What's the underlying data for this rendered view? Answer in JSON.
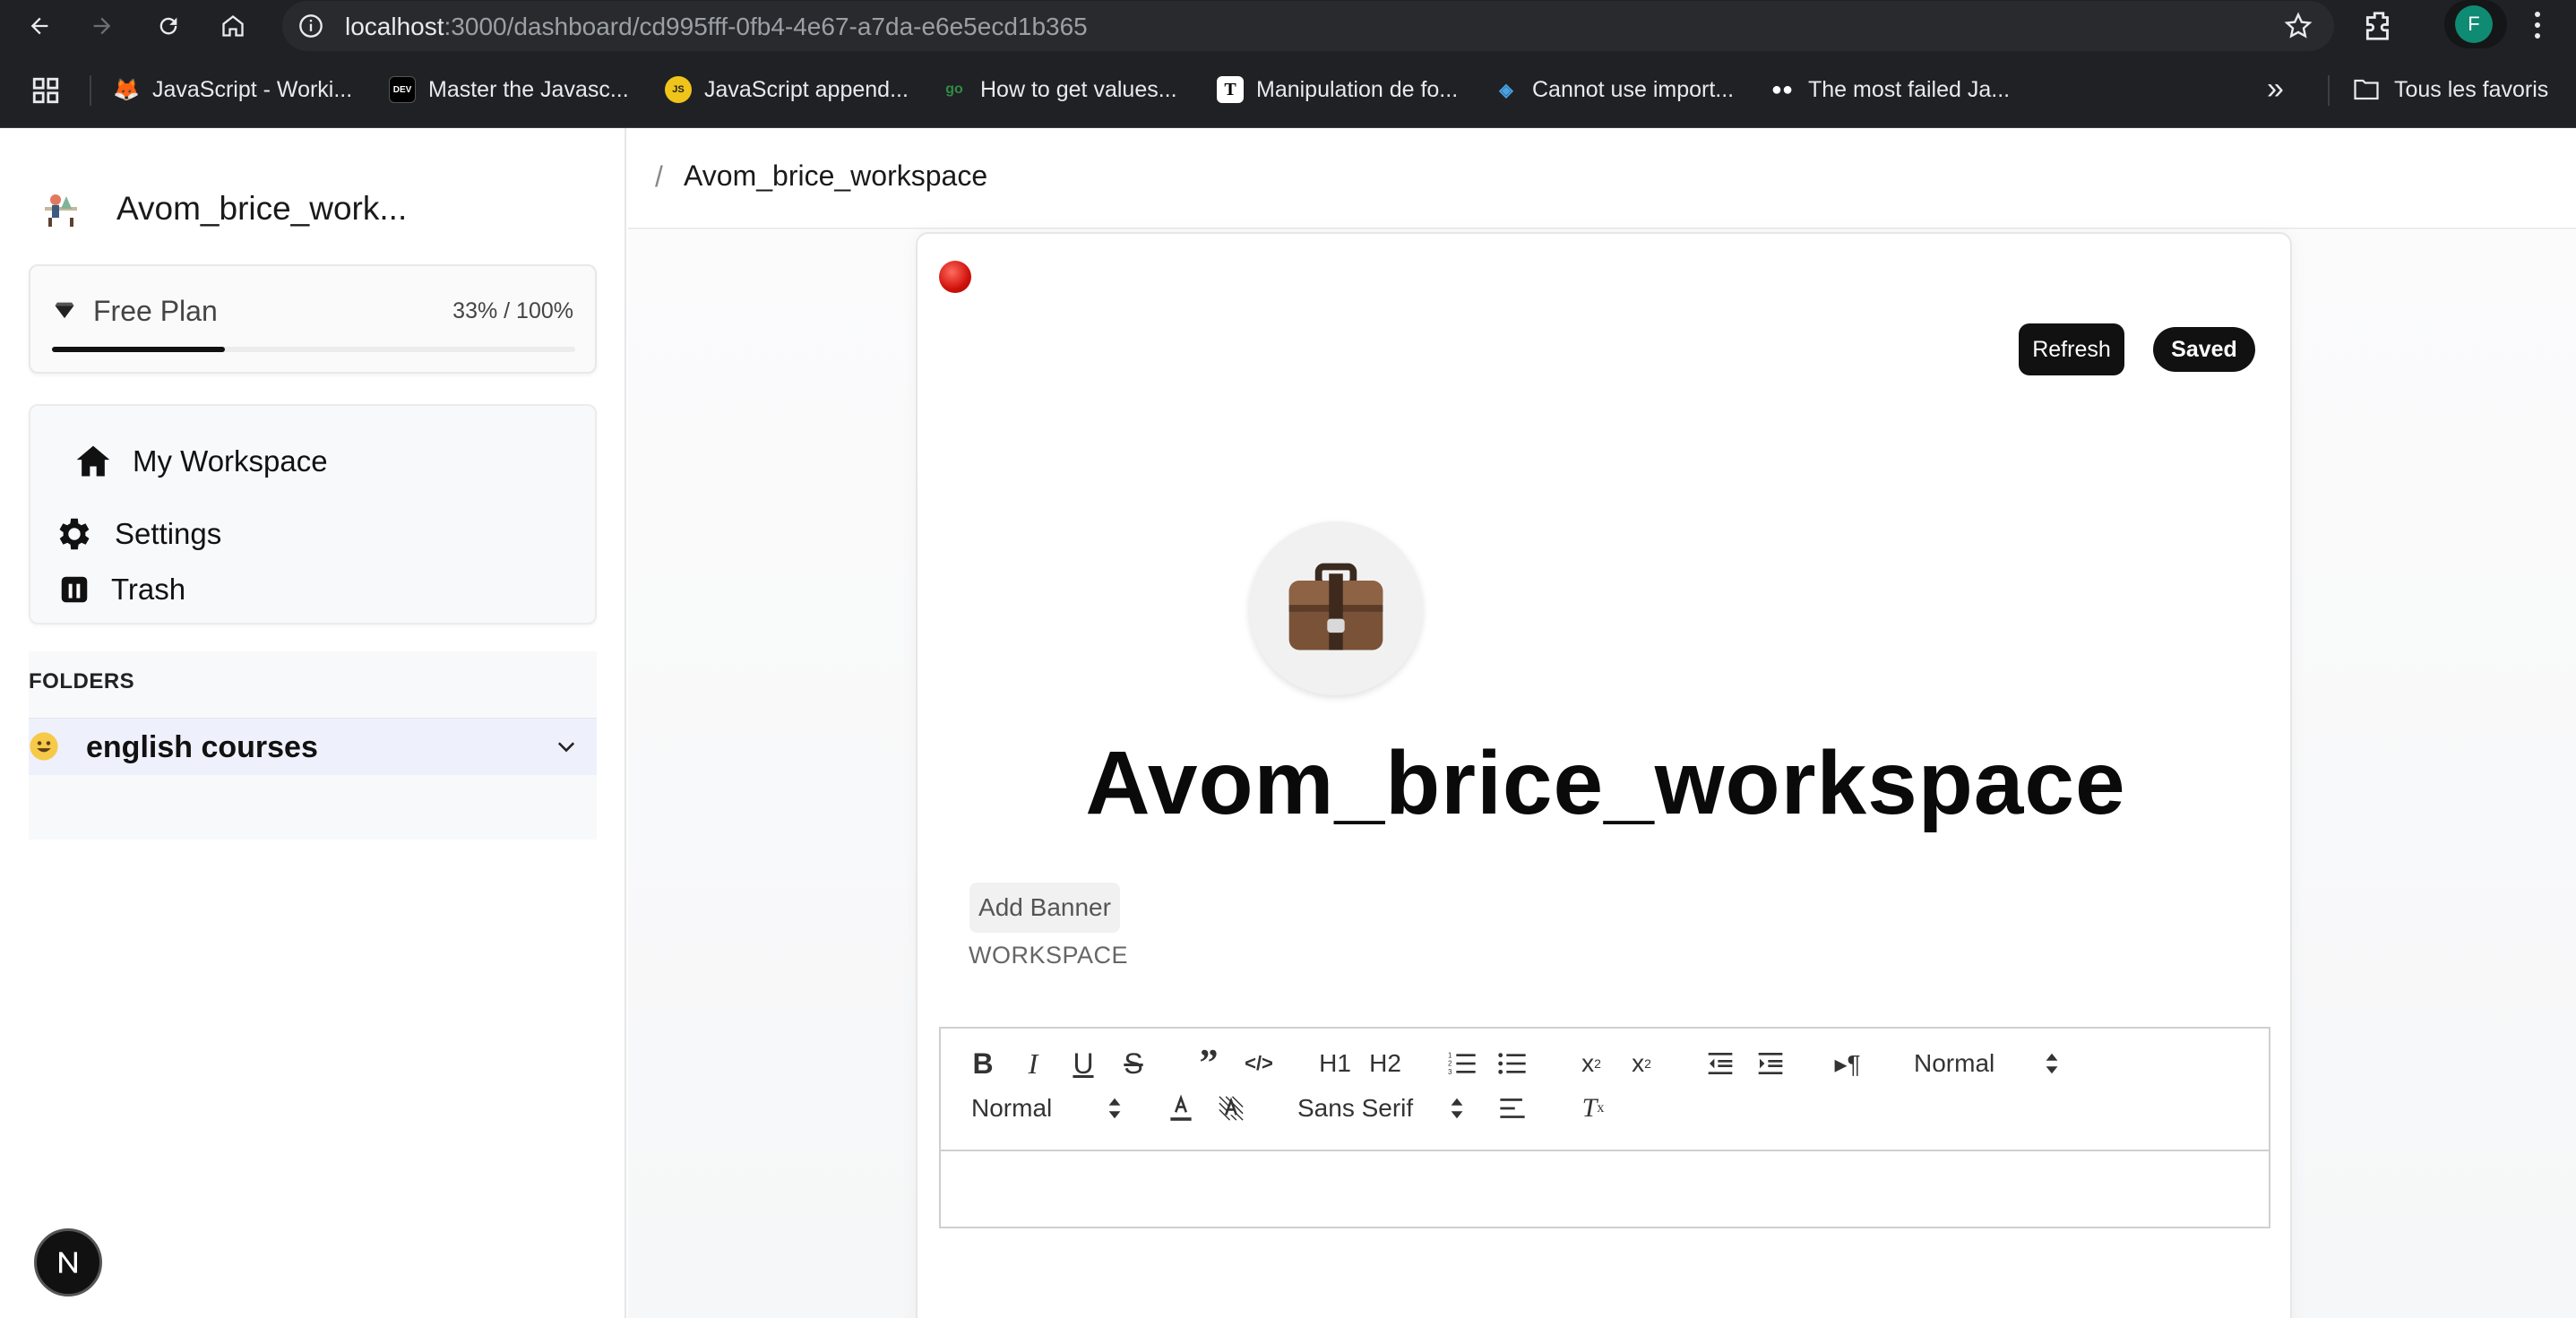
{
  "browser": {
    "url_host": "localhost",
    "url_rest": ":3000/dashboard/cd995fff-0fb4-4e67-a7da-e6e5ecd1b365",
    "profile_initial": "F",
    "bookmarks": [
      "JavaScript - Worki...",
      "Master the Javasc...",
      "JavaScript append...",
      "How to get values...",
      "Manipulation de fo...",
      "Cannot use import...",
      "The most failed Ja..."
    ],
    "bookmark_icons": [
      "JS",
      "DEV",
      "JS",
      "go",
      "T",
      "S",
      "M"
    ],
    "all_bookmarks": "Tous les favoris"
  },
  "sidebar": {
    "workspace_name": "Avom_brice_work...",
    "plan": {
      "label": "Free Plan",
      "usage": "33% / 100%",
      "fill_percent": 33
    },
    "nav": {
      "my_workspace": "My Workspace",
      "settings": "Settings",
      "trash": "Trash"
    },
    "folders_title": "FOLDERS",
    "folders": [
      {
        "emoji": "smiley-face-icon",
        "name": "english courses"
      }
    ],
    "badge_letter": "N"
  },
  "main": {
    "breadcrumb_separator": "/",
    "breadcrumb": "Avom_brice_workspace",
    "buttons": {
      "refresh": "Refresh",
      "saved": "Saved"
    },
    "title": "Avom_brice_workspace",
    "icon": "briefcase-icon",
    "add_banner": "Add Banner",
    "caption": "WORKSPACE",
    "toolbar": {
      "header_select": "Normal",
      "size_select": "Normal",
      "font_select": "Sans Serif",
      "h1": "H1",
      "h2": "H2"
    }
  },
  "colors": {
    "chrome_bg": "#202124",
    "accent_dark": "#111111",
    "folder_highlight": "#eef0fb",
    "profile": "#0f8a73"
  }
}
